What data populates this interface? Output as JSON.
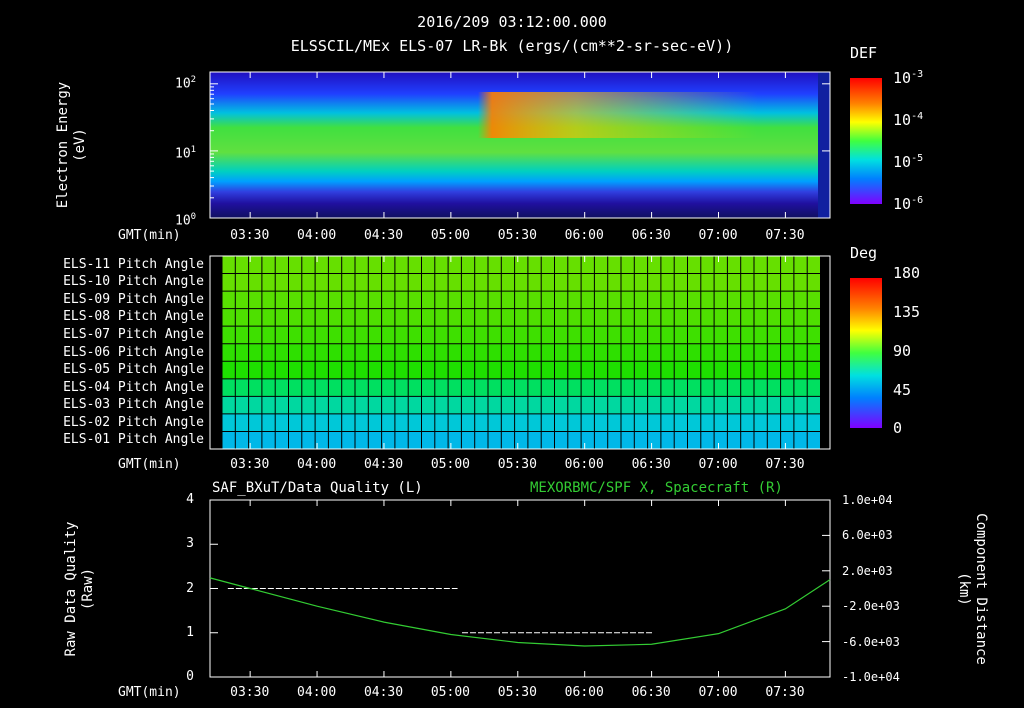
{
  "header": {
    "timestamp": "2016/209 03:12:00.000",
    "subtitle": "ELSSCIL/MEx ELS-07 LR-Bk  (ergs/(cm**2-sr-sec-eV))"
  },
  "time_axis": {
    "label": "GMT(min)",
    "ticks": [
      "03:30",
      "04:00",
      "04:30",
      "05:00",
      "05:30",
      "06:00",
      "06:30",
      "07:00",
      "07:30"
    ]
  },
  "panel1": {
    "ylabel_line1": "Electron Energy",
    "ylabel_line2": "(eV)",
    "colorbar_title": "DEF",
    "colorbar_ticks": [
      {
        "base": "10",
        "exp": "-3"
      },
      {
        "base": "10",
        "exp": "-4"
      },
      {
        "base": "10",
        "exp": "-5"
      },
      {
        "base": "10",
        "exp": "-6"
      }
    ],
    "y_ticks": [
      {
        "base": "10",
        "exp": "2"
      },
      {
        "base": "10",
        "exp": "1"
      },
      {
        "base": "10",
        "exp": "0"
      }
    ]
  },
  "panel2": {
    "colorbar_title": "Deg",
    "colorbar_ticks": [
      "180",
      "135",
      "90",
      "45",
      "0"
    ],
    "row_labels": [
      "ELS-11 Pitch Angle",
      "ELS-10 Pitch Angle",
      "ELS-09 Pitch Angle",
      "ELS-08 Pitch Angle",
      "ELS-07 Pitch Angle",
      "ELS-06 Pitch Angle",
      "ELS-05 Pitch Angle",
      "ELS-04 Pitch Angle",
      "ELS-03 Pitch Angle",
      "ELS-02 Pitch Angle",
      "ELS-01 Pitch Angle"
    ],
    "row_colors": [
      "#66e000",
      "#66e000",
      "#58e000",
      "#4ee000",
      "#3ee000",
      "#2ee000",
      "#1ee000",
      "#00e060",
      "#00d8a0",
      "#00c8d8",
      "#00b8e8"
    ]
  },
  "panel3": {
    "left_title": "SAF_BXuT/Data Quality (L)",
    "right_title": "MEXORBMC/SPF X, Spacecraft (R)",
    "ylabel_left_line1": "Raw Data Quality",
    "ylabel_left_line2": "(Raw)",
    "ylabel_right_line1": "Component Distance",
    "ylabel_right_line2": "(km)",
    "left_ticks": [
      "4",
      "3",
      "2",
      "1",
      "0"
    ],
    "right_ticks": [
      "1.0e+04",
      "6.0e+03",
      "2.0e+03",
      "-2.0e+03",
      "-6.0e+03",
      "-1.0e+04"
    ],
    "series_color": "#33cc33"
  },
  "chart_data": [
    {
      "type": "heatmap",
      "title": "ELSSCIL/MEx ELS-07 LR-Bk  (ergs/(cm**2-sr-sec-eV))",
      "xlabel": "GMT(min)",
      "ylabel": "Electron Energy (eV)",
      "x_range": [
        "03:12",
        "07:50"
      ],
      "ylim": [
        1,
        150
      ],
      "yscale": "log",
      "colorbar": {
        "label": "DEF",
        "scale": "log",
        "range": [
          1e-06,
          0.001
        ]
      },
      "x": [
        "03:30",
        "04:00",
        "04:30",
        "05:00",
        "05:30",
        "06:00",
        "06:30",
        "07:00",
        "07:30"
      ],
      "peak_energy_eV": [
        20,
        20,
        20,
        20,
        22,
        20,
        20,
        20,
        20
      ],
      "peak_def": [
        8e-05,
        6e-05,
        6e-05,
        6e-05,
        0.0003,
        0.0002,
        0.0001,
        8e-05,
        8e-05
      ]
    },
    {
      "type": "heatmap",
      "xlabel": "GMT(min)",
      "colorbar": {
        "label": "Deg",
        "range": [
          0,
          180
        ]
      },
      "x_range": [
        "03:12",
        "07:50"
      ],
      "rows": [
        "ELS-11",
        "ELS-10",
        "ELS-09",
        "ELS-08",
        "ELS-07",
        "ELS-06",
        "ELS-05",
        "ELS-04",
        "ELS-03",
        "ELS-02",
        "ELS-01"
      ],
      "pitch_angle_deg": [
        110,
        108,
        105,
        102,
        98,
        94,
        90,
        75,
        65,
        55,
        50
      ]
    },
    {
      "type": "line",
      "xlabel": "GMT(min)",
      "x_range": [
        "03:12",
        "07:50"
      ],
      "series": [
        {
          "name": "SAF_BXuT/Data Quality (L)",
          "axis": "left",
          "ylim": [
            0,
            4
          ],
          "x": [
            "03:20",
            "05:03",
            "05:05",
            "06:31",
            "06:33",
            "07:46"
          ],
          "values": [
            2,
            2,
            1,
            1,
            0,
            0
          ]
        },
        {
          "name": "MEXORBMC/SPF X, Spacecraft (R)",
          "axis": "right",
          "ylim": [
            -10000,
            10000
          ],
          "x": [
            "03:12",
            "03:30",
            "04:00",
            "04:30",
            "05:00",
            "05:30",
            "06:00",
            "06:30",
            "07:00",
            "07:30",
            "07:50"
          ],
          "values": [
            1200,
            0,
            -2000,
            -3800,
            -5200,
            -6100,
            -6500,
            -6300,
            -5100,
            -2300,
            1000
          ]
        }
      ]
    }
  ]
}
